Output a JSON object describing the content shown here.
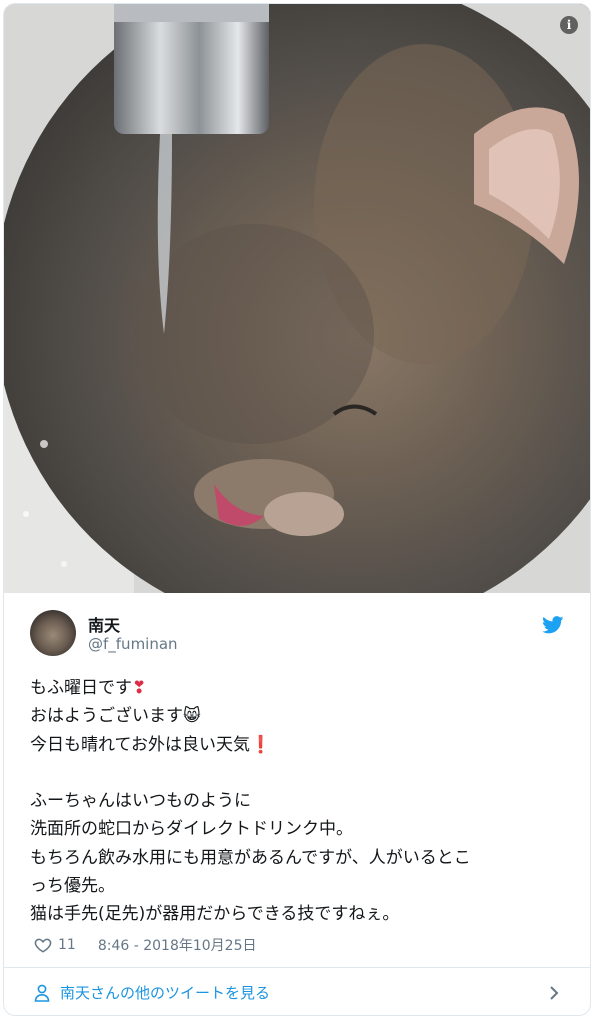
{
  "author": {
    "name": "南天",
    "handle": "@f_fuminan"
  },
  "tweet": {
    "lines": [
      "もふ曜日です",
      "おはようございます",
      "今日も晴れてお外は良い天気",
      "",
      "ふーちゃんはいつものように",
      "洗面所の蛇口からダイレクトドリンク中。",
      "もちろん飲み水用にも用意があるんですが、人がいるとこ",
      "っち優先。",
      "猫は手先(足先)が器用だからできる技ですねぇ。"
    ],
    "emojis": {
      "line1": "❣",
      "line2": "😸",
      "line3": "❗"
    }
  },
  "meta": {
    "like_count": "11",
    "timestamp": "8:46 - 2018年10月25日"
  },
  "footer": {
    "more_label": "南天さんの他のツイートを見る"
  },
  "media": {
    "info_label": "i"
  },
  "colors": {
    "link": "#1b95e0",
    "secondary": "#657786",
    "twitter_blue": "#1da1f2"
  },
  "icons": [
    "info-icon",
    "twitter-bird-icon",
    "heart-icon",
    "person-icon",
    "chevron-right-icon"
  ]
}
